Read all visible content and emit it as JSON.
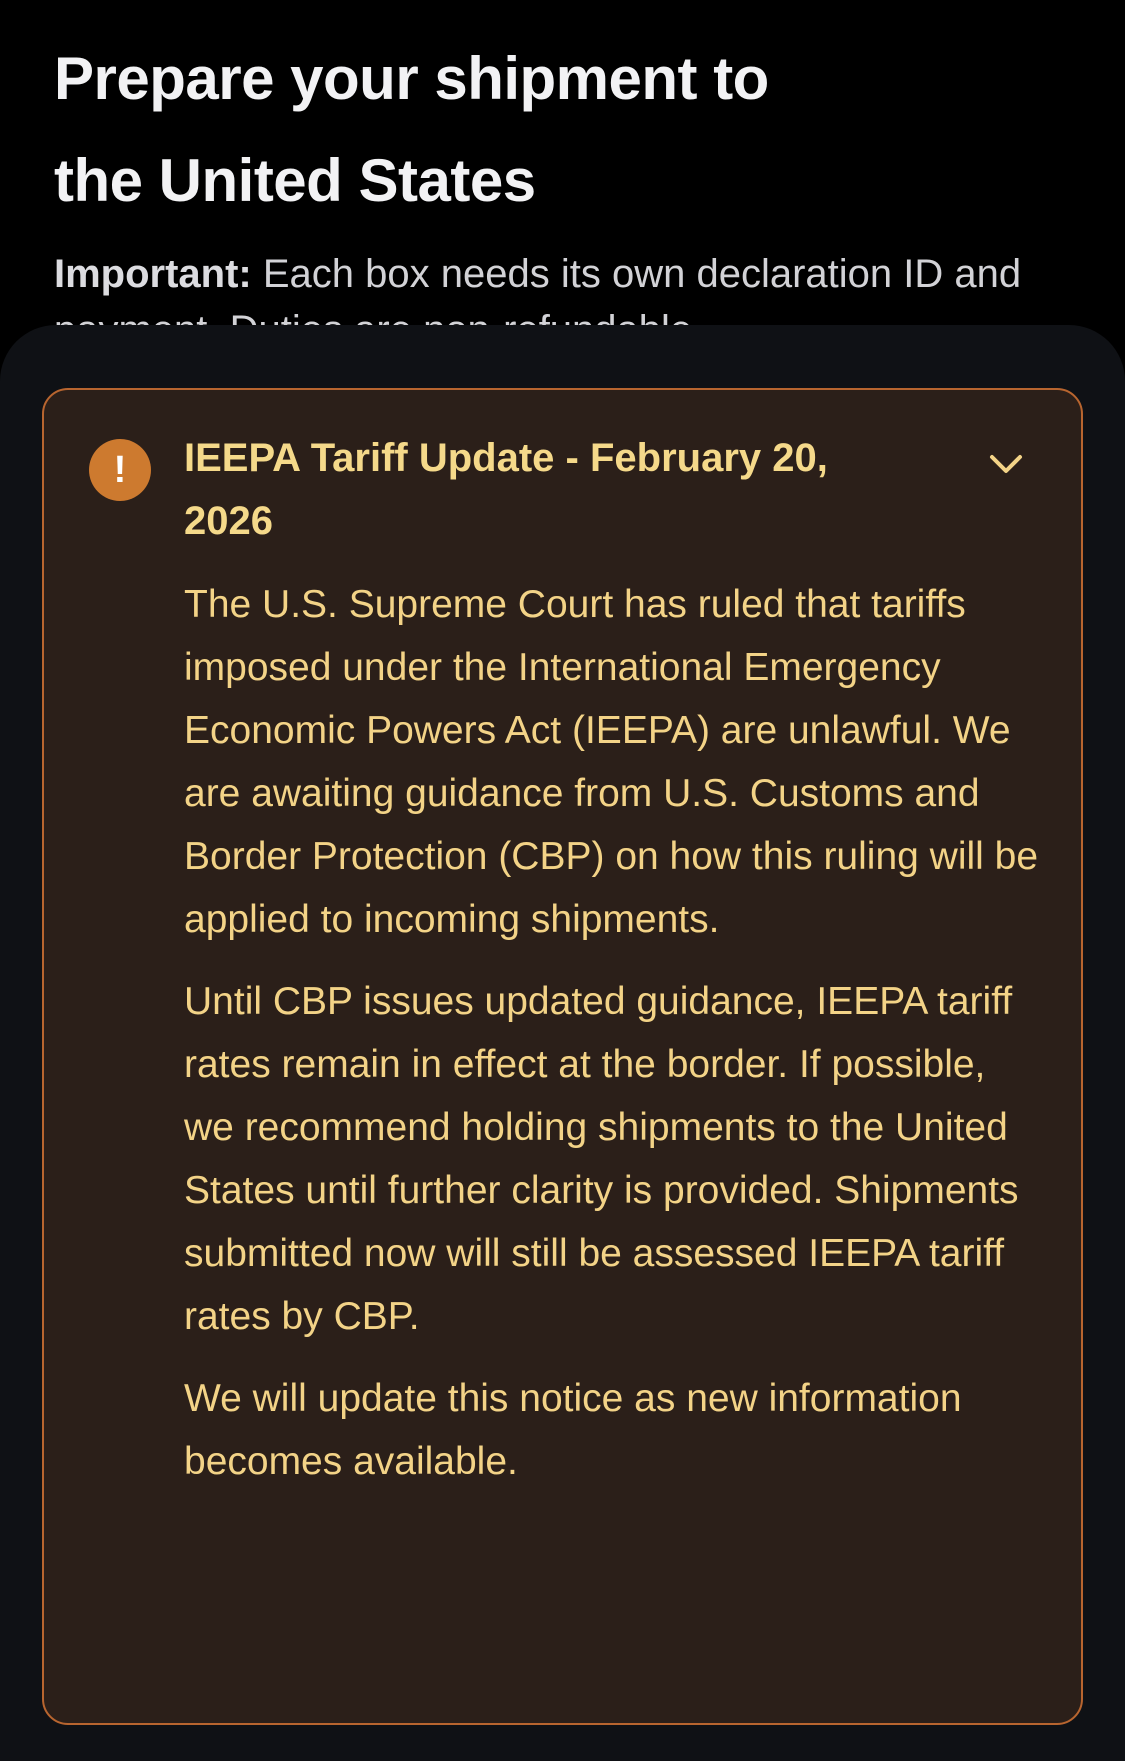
{
  "header": {
    "title_line1": "Prepare your shipment to",
    "title_line2": "the United States",
    "important_label": "Important:",
    "important_text": " Each box needs its own declaration ID and payment. Duties are non-refundable."
  },
  "notice": {
    "icon": "exclamation-icon",
    "title": "IEEPA Tariff Update - February 20, 2026",
    "paragraphs": [
      "The U.S. Supreme Court has ruled that tariffs imposed under the International Emergency Economic Powers Act (IEEPA) are unlawful. We are awaiting guidance from U.S. Customs and Border Protection (CBP) on how this ruling will be applied to incoming shipments.",
      "Until CBP issues updated guidance, IEEPA tariff rates remain in effect at the border. If possible, we recommend holding shipments to the United States until further clarity is provided. Shipments submitted now will still be assessed IEEPA tariff rates by CBP.",
      "We will update this notice as new information becomes available."
    ],
    "expand_icon": "chevron-down-icon"
  },
  "colors": {
    "page_background": "#000000",
    "sheet_background": "#0f1115",
    "notice_background": "#2b1f19",
    "notice_border": "#b8652f",
    "notice_text": "#f3d387",
    "alert_icon": "#cd7a2f"
  }
}
